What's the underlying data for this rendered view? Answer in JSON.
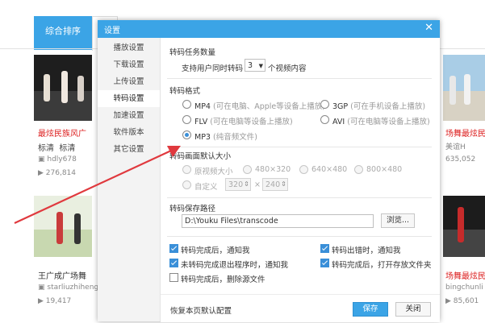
{
  "background": {
    "tabs": {
      "active": "综合排序"
    },
    "left_videos": [
      {
        "title": "最炫民族风广",
        "quality": "标清",
        "quality2": "标清",
        "author": "hdly678",
        "views": "276,814"
      },
      {
        "title": "王广成广场舞",
        "author": "starliuzhiheng",
        "views": "19,417"
      }
    ],
    "right_videos": [
      {
        "title": "场舞最炫民",
        "sub": "美谊H",
        "views": "635,052"
      },
      {
        "title": "场舞最炫民族",
        "author": "bingchunli",
        "views": "85,601"
      }
    ]
  },
  "dialog": {
    "title": "设置",
    "close": "✕",
    "nav": [
      "播放设置",
      "下载设置",
      "上传设置",
      "转码设置",
      "加速设置",
      "软件版本",
      "其它设置"
    ],
    "selected_nav": "转码设置",
    "task": {
      "heading": "转码任务数量",
      "prefix": "支持用户同时转码",
      "value": "3",
      "suffix": "个视频内容"
    },
    "format": {
      "heading": "转码格式",
      "options": [
        {
          "label": "MP4",
          "hint": "(可在电脑、Apple等设备上播放)"
        },
        {
          "label": "3GP",
          "hint": "(可在手机设备上播放)"
        },
        {
          "label": "FLV",
          "hint": "(可在电脑等设备上播放)"
        },
        {
          "label": "AVI",
          "hint": "(可在电脑等设备上播放)"
        },
        {
          "label": "MP3",
          "hint": "(纯音频文件)"
        }
      ],
      "selected": "MP3"
    },
    "resolution": {
      "heading": "转码画面默认大小",
      "options": [
        "原视频大小",
        "480×320",
        "640×480",
        "800×480"
      ],
      "custom": "自定义",
      "width": "320",
      "times": "×",
      "height": "240"
    },
    "path": {
      "heading": "转码保存路径",
      "value": "D:\\Youku Files\\transcode",
      "browse": "浏览..."
    },
    "checks": [
      {
        "label": "转码完成后，通知我",
        "checked": true
      },
      {
        "label": "转码出错时，通知我",
        "checked": true
      },
      {
        "label": "未转码完成退出程序时，通知我",
        "checked": true
      },
      {
        "label": "转码完成后，打开存放文件夹",
        "checked": true
      },
      {
        "label": "转码完成后，删除源文件",
        "checked": false
      }
    ],
    "footer": {
      "restore": "恢复本页默认配置",
      "save": "保存",
      "close": "关闭"
    }
  },
  "colors": {
    "accent": "#3ba4e6",
    "arrow": "#e0393e",
    "title_red": "#d22222"
  }
}
